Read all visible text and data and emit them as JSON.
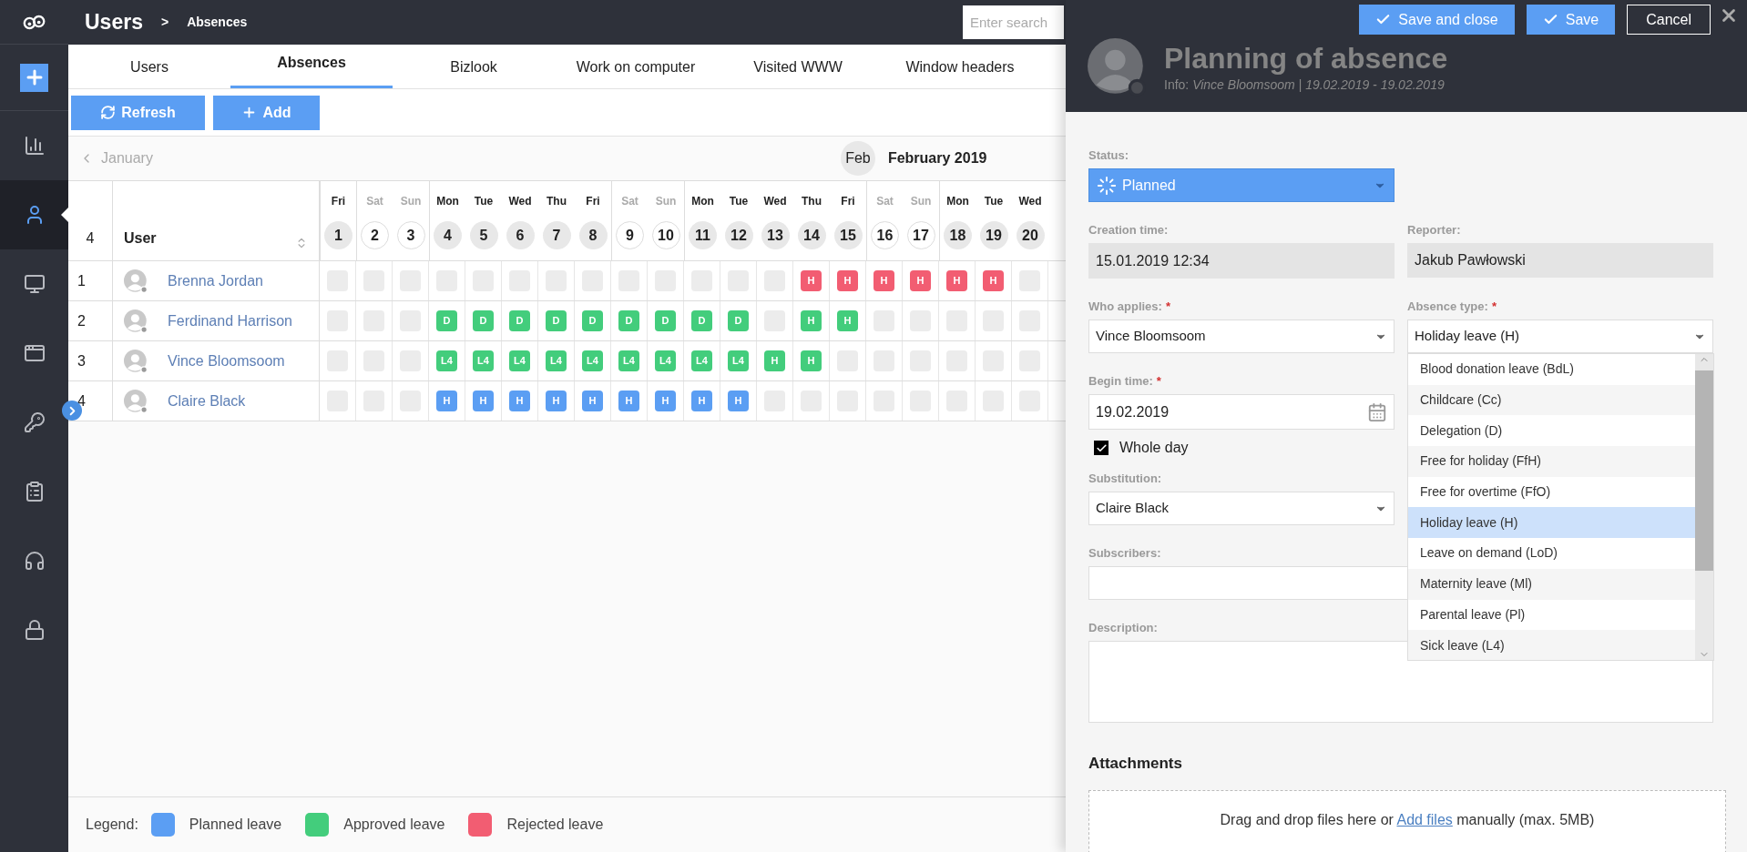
{
  "sidebar": {
    "items": [
      {
        "selected": false
      },
      {
        "selected": true
      },
      {
        "selected": false
      },
      {
        "selected": false
      },
      {
        "selected": false
      },
      {
        "selected": false
      },
      {
        "selected": false
      },
      {
        "selected": false
      }
    ]
  },
  "header": {
    "title": "Users",
    "separator": ">",
    "subtitle": "Absences",
    "search": {
      "placeholder": "Enter search"
    }
  },
  "tabs": [
    {
      "label": "Users",
      "selected": false
    },
    {
      "label": "Absences",
      "selected": true
    },
    {
      "label": "Bizlook",
      "selected": false
    },
    {
      "label": "Work on computer",
      "selected": false
    },
    {
      "label": "Visited WWW",
      "selected": false
    },
    {
      "label": "Window headers",
      "selected": false
    }
  ],
  "toolbar": {
    "buttons": [
      {
        "label": "Refresh",
        "kind": "refresh"
      },
      {
        "label": "Add",
        "kind": "add"
      }
    ]
  },
  "calendar": {
    "prev_month": "January",
    "month_badge": "Feb",
    "month": "February 2019",
    "row_count": "4",
    "user_column": "User",
    "days": [
      {
        "weekday": "Fri",
        "day": "1",
        "weekend": false
      },
      {
        "weekday": "Sat",
        "day": "2",
        "weekend": true
      },
      {
        "weekday": "Sun",
        "day": "3",
        "weekend": true
      },
      {
        "weekday": "Mon",
        "day": "4",
        "weekend": false
      },
      {
        "weekday": "Tue",
        "day": "5",
        "weekend": false
      },
      {
        "weekday": "Wed",
        "day": "6",
        "weekend": false
      },
      {
        "weekday": "Thu",
        "day": "7",
        "weekend": false
      },
      {
        "weekday": "Fri",
        "day": "8",
        "weekend": false
      },
      {
        "weekday": "Sat",
        "day": "9",
        "weekend": true
      },
      {
        "weekday": "Sun",
        "day": "10",
        "weekend": true
      },
      {
        "weekday": "Mon",
        "day": "11",
        "weekend": false
      },
      {
        "weekday": "Tue",
        "day": "12",
        "weekend": false
      },
      {
        "weekday": "Wed",
        "day": "13",
        "weekend": false
      },
      {
        "weekday": "Thu",
        "day": "14",
        "weekend": false
      },
      {
        "weekday": "Fri",
        "day": "15",
        "weekend": false
      },
      {
        "weekday": "Sat",
        "day": "16",
        "weekend": true
      },
      {
        "weekday": "Sun",
        "day": "17",
        "weekend": true
      },
      {
        "weekday": "Mon",
        "day": "18",
        "weekend": false
      },
      {
        "weekday": "Tue",
        "day": "19",
        "weekend": false
      },
      {
        "weekday": "Wed",
        "day": "20",
        "weekend": false
      }
    ],
    "rows": [
      {
        "index": "1",
        "name": "Brenna Jordan",
        "cells": [
          {
            "empty": true
          },
          {
            "empty": true
          },
          {
            "empty": true
          },
          {
            "empty": true
          },
          {
            "empty": true
          },
          {
            "empty": true
          },
          {
            "empty": true
          },
          {
            "empty": true
          },
          {
            "empty": true
          },
          {
            "empty": true
          },
          {
            "empty": true
          },
          {
            "empty": true
          },
          {
            "empty": true
          },
          {
            "code": "H",
            "color": "#f25d72"
          },
          {
            "code": "H",
            "color": "#f25d72"
          },
          {
            "code": "H",
            "color": "#f25d72"
          },
          {
            "code": "H",
            "color": "#f25d72"
          },
          {
            "code": "H",
            "color": "#f25d72"
          },
          {
            "code": "H",
            "color": "#f25d72"
          },
          {
            "empty": true
          }
        ]
      },
      {
        "index": "2",
        "name": "Ferdinand Harrison",
        "cells": [
          {
            "empty": true
          },
          {
            "empty": true
          },
          {
            "empty": true
          },
          {
            "code": "D",
            "color": "#43cd7c"
          },
          {
            "code": "D",
            "color": "#43cd7c"
          },
          {
            "code": "D",
            "color": "#43cd7c"
          },
          {
            "code": "D",
            "color": "#43cd7c"
          },
          {
            "code": "D",
            "color": "#43cd7c"
          },
          {
            "code": "D",
            "color": "#43cd7c"
          },
          {
            "code": "D",
            "color": "#43cd7c"
          },
          {
            "code": "D",
            "color": "#43cd7c"
          },
          {
            "code": "D",
            "color": "#43cd7c"
          },
          {
            "empty": true
          },
          {
            "code": "H",
            "color": "#43cd7c"
          },
          {
            "code": "H",
            "color": "#43cd7c"
          },
          {
            "empty": true
          },
          {
            "empty": true
          },
          {
            "empty": true
          },
          {
            "empty": true
          },
          {
            "empty": true
          }
        ]
      },
      {
        "index": "3",
        "name": "Vince Bloomsoom",
        "cells": [
          {
            "empty": true
          },
          {
            "empty": true
          },
          {
            "empty": true
          },
          {
            "code": "L4",
            "color": "#43cd7c"
          },
          {
            "code": "L4",
            "color": "#43cd7c"
          },
          {
            "code": "L4",
            "color": "#43cd7c"
          },
          {
            "code": "L4",
            "color": "#43cd7c"
          },
          {
            "code": "L4",
            "color": "#43cd7c"
          },
          {
            "code": "L4",
            "color": "#43cd7c"
          },
          {
            "code": "L4",
            "color": "#43cd7c"
          },
          {
            "code": "L4",
            "color": "#43cd7c"
          },
          {
            "code": "L4",
            "color": "#43cd7c"
          },
          {
            "code": "H",
            "color": "#43cd7c"
          },
          {
            "code": "H",
            "color": "#43cd7c"
          },
          {
            "empty": true
          },
          {
            "empty": true
          },
          {
            "empty": true
          },
          {
            "empty": true
          },
          {
            "empty": true
          },
          {
            "empty": true
          }
        ]
      },
      {
        "index": "4",
        "name": "Claire Black",
        "cells": [
          {
            "empty": true
          },
          {
            "empty": true
          },
          {
            "empty": true
          },
          {
            "code": "H",
            "color": "#5b9ef3"
          },
          {
            "code": "H",
            "color": "#5b9ef3"
          },
          {
            "code": "H",
            "color": "#5b9ef3"
          },
          {
            "code": "H",
            "color": "#5b9ef3"
          },
          {
            "code": "H",
            "color": "#5b9ef3"
          },
          {
            "code": "H",
            "color": "#5b9ef3"
          },
          {
            "code": "H",
            "color": "#5b9ef3"
          },
          {
            "code": "H",
            "color": "#5b9ef3"
          },
          {
            "code": "H",
            "color": "#5b9ef3"
          },
          {
            "empty": true
          },
          {
            "empty": true
          },
          {
            "empty": true
          },
          {
            "empty": true
          },
          {
            "empty": true
          },
          {
            "empty": true
          },
          {
            "empty": true
          },
          {
            "empty": true
          }
        ]
      }
    ]
  },
  "legend": {
    "label": "Legend:",
    "items": [
      {
        "label": "Planned leave",
        "color": "#5b9ef3"
      },
      {
        "label": "Approved leave",
        "color": "#43cd7c"
      },
      {
        "label": "Rejected leave",
        "color": "#f25d72"
      }
    ]
  },
  "panel": {
    "buttons": [
      {
        "label": "Save and close",
        "kind": "primary"
      },
      {
        "label": "Save",
        "kind": "primary"
      },
      {
        "label": "Cancel",
        "kind": "outline"
      }
    ],
    "title": "Planning of absence",
    "info": "Info: *Vince Bloomsoom | 19.02.2019 - 19.02.2019*",
    "status": {
      "label": "Status:",
      "value": "Planned"
    },
    "creation_time": {
      "label": "Creation time:",
      "value": "15.01.2019 12:34"
    },
    "reporter": {
      "label": "Reporter:",
      "value": "Jakub Pawłowski"
    },
    "who_applies": {
      "label": "Who applies:",
      "required_mark": "*",
      "value": "Vince Bloomsoom"
    },
    "absence_type": {
      "label": "Absence type:",
      "required_mark": "*",
      "value": "Holiday leave (H)",
      "expanded": true,
      "options": [
        {
          "label": "Blood donation leave (BdL)",
          "selected": false
        },
        {
          "label": "Childcare (Cc)",
          "selected": false
        },
        {
          "label": "Delegation (D)",
          "selected": false
        },
        {
          "label": "Free for holiday (FfH)",
          "selected": false
        },
        {
          "label": "Free for overtime (FfO)",
          "selected": false
        },
        {
          "label": "Holiday leave (H)",
          "selected": true
        },
        {
          "label": "Leave on demand (LoD)",
          "selected": false
        },
        {
          "label": "Maternity leave (Ml)",
          "selected": false
        },
        {
          "label": "Parental leave (Pl)",
          "selected": false
        },
        {
          "label": "Sick leave (L4)",
          "selected": false
        }
      ]
    },
    "begin_time": {
      "label": "Begin time:",
      "required_mark": "*",
      "value": "19.02.2019"
    },
    "whole_day": {
      "label": "Whole day",
      "checked": true
    },
    "substitution": {
      "label": "Substitution:",
      "value": "Claire Black"
    },
    "subscribers": {
      "label": "Subscribers:"
    },
    "description": {
      "label": "Description:"
    },
    "attachments": {
      "title": "Attachments",
      "text_before": "Drag and drop files here or",
      "link": "Add files",
      "text_after": "manually (max. 5MB)"
    }
  }
}
